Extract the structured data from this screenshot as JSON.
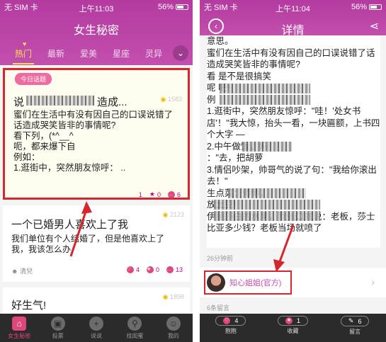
{
  "left": {
    "status": {
      "carrier": "无 SIM 卡",
      "time": "上午11:03",
      "battery": "56%"
    },
    "title": "女生秘密",
    "tabs": [
      "热门",
      "最新",
      "爱美",
      "星座",
      "灵异"
    ],
    "card1": {
      "badge": "今日话题",
      "views": "1583",
      "title": "说",
      "title_tail": "造成...",
      "text": "蜜们在生活中有没有因自己的口误说错了话造成哭笑皆非的事情呢?\n看下列，(*^__^\n呃，都来爆下自\n例如：\n1.逛街中，突然朋友惊呼：  ..",
      "stats": {
        "likes": "1",
        "stars": "0",
        "comments": "6"
      }
    },
    "card2": {
      "views": "2123",
      "title": "一个已婚男人喜欢上了我",
      "text": "我们单位有个人结婚了，但是他喜欢上了我，我该怎么办",
      "author": "清兒",
      "stats": {
        "likes": "4",
        "stars": "0",
        "comments": "13"
      }
    },
    "card3": {
      "views": "1898",
      "title": "好生气!"
    },
    "nav": [
      "女生秘密",
      "投票",
      "说说",
      "找闺蜜",
      "我的"
    ]
  },
  "right": {
    "status": {
      "carrier": "无 SIM 卡",
      "time": "上午11:04",
      "battery": "56%"
    },
    "title": "详情",
    "body": "意思。\n蜜们在生活中有没有因自己的口误说错了话造成哭笑皆非的事情呢?\n看                              是不是很搞笑\n呢                              吧!\n例\n1.逛街中，突然朋友惊呼：\"哇！'处女书店'！\"我大惊，抬头一看，一块匾额，上书四个大字 —\n2.中午做饭，妈\n：\"去，把胡萝\n3.情侣吵架，帅哥气的说了句：\"我给你滚出去！\"\n                              生点菜：师傅，\n                              放土豆!\n                              伊丽莎白的水果，我张口就说：老板，莎士比亚多少钱？老板当场就喷了",
    "time_ago": "26分钟前",
    "author": "知心姐姐(官方)",
    "comments_count": "6条留言",
    "actions": [
      {
        "count": "4",
        "label": "抱抱"
      },
      {
        "count": "1",
        "label": "收藏"
      },
      {
        "count": "6",
        "label": "留言"
      }
    ]
  },
  "colors": {
    "header": "#b43aa0",
    "accent": "#e0457b",
    "highlight": "#d4262b",
    "active_tab": "#ffe24a"
  }
}
